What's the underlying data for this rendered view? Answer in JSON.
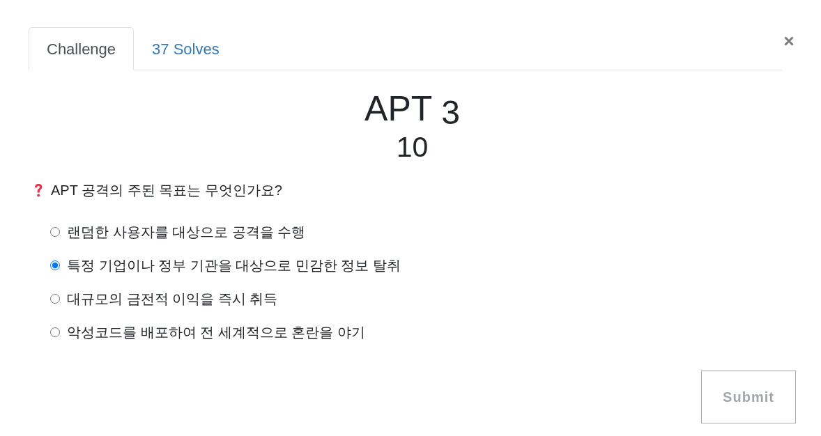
{
  "tabs": [
    {
      "label": "Challenge",
      "selected": true
    },
    {
      "label": "37 Solves",
      "selected": false
    }
  ],
  "challenge": {
    "title": "APT $_{3}$",
    "value": "10"
  },
  "question": {
    "text": "APT 공격의 주된 목표는 무엇인가요?",
    "options": [
      {
        "text": "랜덤한 사용자를 대상으로 공격을 수행",
        "selected": false
      },
      {
        "text": "특정 기업이나 정부 기관을 대상으로 민감한 정보 탈취",
        "selected": true
      },
      {
        "text": "대규모의 금전적 이익을 즉시 취득",
        "selected": false
      },
      {
        "text": "악성코드를 배포하여 전 세계적으로 혼란을 야기",
        "selected": false
      }
    ]
  },
  "submit_button": {
    "label": "Submit",
    "disabled": true
  }
}
